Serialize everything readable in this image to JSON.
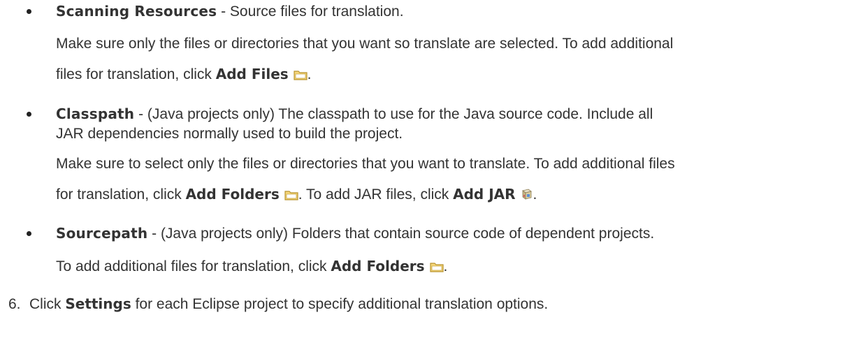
{
  "items": [
    {
      "term": "Scanning Resources",
      "desc": " - Source files for translation.",
      "para_a": "Make sure only the files or directories that you want so translate are selected. To add additional",
      "para_b_pre": "files for translation, click ",
      "para_b_bold": "Add Files",
      "para_b_post": ".",
      "icon": "folder-icon"
    },
    {
      "term": "Classpath",
      "desc": " - (Java projects only) The classpath to use for the Java source code. Include all",
      "desc2": "JAR dependencies normally used to build the project.",
      "para_a": "Make sure to select only the files or directories that you want to translate. To add additional files",
      "para_b_pre": "for translation, click ",
      "para_b_bold": "Add Folders",
      "para_b_mid": ". To add JAR files, click ",
      "para_b_bold2": "Add JAR",
      "para_b_post": ".",
      "icons": [
        "folder-icon",
        "jar-icon"
      ]
    },
    {
      "term": "Sourcepath",
      "desc": " - (Java projects only) Folders that contain source code of dependent projects.",
      "para_pre": "To add additional files for translation, click ",
      "para_bold": "Add Folders",
      "para_post": ".",
      "icon": "folder-icon"
    }
  ],
  "step": {
    "number": "6.",
    "pre": "Click ",
    "bold": "Settings",
    "post": " for each Eclipse project to specify additional translation options."
  },
  "colors": {
    "text": "#333333",
    "folder_fill": "#f6d77a",
    "folder_border": "#b8922e"
  }
}
